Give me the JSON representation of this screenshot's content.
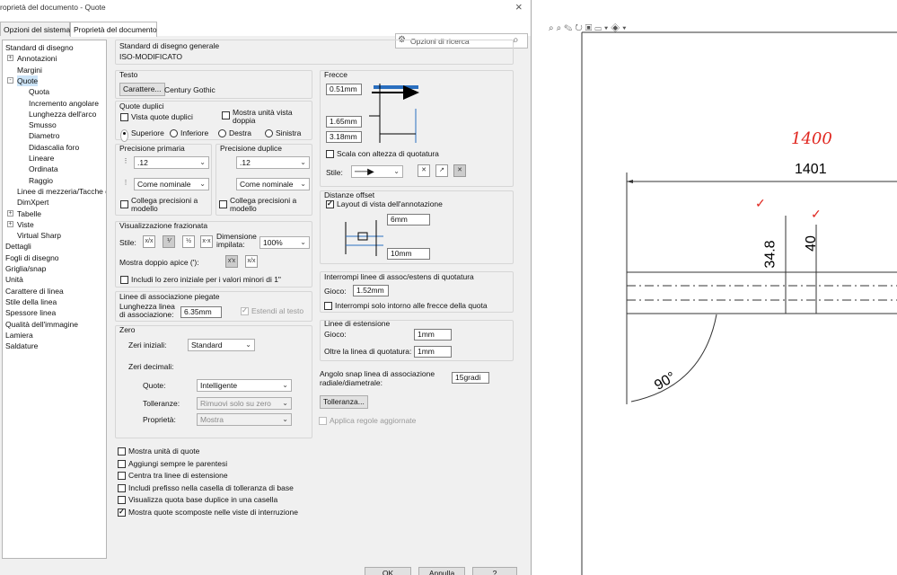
{
  "window": {
    "title": "roprietà del documento - Quote",
    "close": "×"
  },
  "tabs": [
    {
      "label": "Opzioni del sistema"
    },
    {
      "label": "Proprietà del documento"
    }
  ],
  "search": {
    "placeholder": "Opzioni di ricerca"
  },
  "tree": [
    {
      "label": "Standard di disegno",
      "indent": 0,
      "exp": ""
    },
    {
      "label": "Annotazioni",
      "indent": 1,
      "exp": "+"
    },
    {
      "label": "Margini",
      "indent": 1,
      "exp": ""
    },
    {
      "label": "Quote",
      "indent": 1,
      "exp": "-"
    },
    {
      "label": "Quota",
      "indent": 2,
      "exp": ""
    },
    {
      "label": "Incremento angolare",
      "indent": 2,
      "exp": ""
    },
    {
      "label": "Lunghezza dell'arco",
      "indent": 2,
      "exp": ""
    },
    {
      "label": "Smusso",
      "indent": 2,
      "exp": ""
    },
    {
      "label": "Diametro",
      "indent": 2,
      "exp": ""
    },
    {
      "label": "Didascalia foro",
      "indent": 2,
      "exp": ""
    },
    {
      "label": "Lineare",
      "indent": 2,
      "exp": ""
    },
    {
      "label": "Ordinata",
      "indent": 2,
      "exp": ""
    },
    {
      "label": "Raggio",
      "indent": 2,
      "exp": ""
    },
    {
      "label": "Linee di mezzeria/Tacche d",
      "indent": 1,
      "exp": ""
    },
    {
      "label": "DimXpert",
      "indent": 1,
      "exp": ""
    },
    {
      "label": "Tabelle",
      "indent": 1,
      "exp": "+"
    },
    {
      "label": "Viste",
      "indent": 1,
      "exp": "+"
    },
    {
      "label": "Virtual Sharp",
      "indent": 1,
      "exp": ""
    },
    {
      "label": "Dettagli",
      "indent": 0,
      "exp": ""
    },
    {
      "label": "Fogli di disegno",
      "indent": 0,
      "exp": ""
    },
    {
      "label": "Griglia/snap",
      "indent": 0,
      "exp": ""
    },
    {
      "label": "Unità",
      "indent": 0,
      "exp": ""
    },
    {
      "label": "Carattere di linea",
      "indent": 0,
      "exp": ""
    },
    {
      "label": "Stile della linea",
      "indent": 0,
      "exp": ""
    },
    {
      "label": "Spessore linea",
      "indent": 0,
      "exp": ""
    },
    {
      "label": "Qualità dell'immagine",
      "indent": 0,
      "exp": ""
    },
    {
      "label": "Lamiera",
      "indent": 0,
      "exp": ""
    },
    {
      "label": "Saldature",
      "indent": 0,
      "exp": ""
    }
  ],
  "standard": {
    "title": "Standard di disegno generale",
    "value": "ISO-MODIFICATO"
  },
  "testo": {
    "title": "Testo",
    "button": "Carattere...",
    "font": "Century Gothic"
  },
  "dual": {
    "title": "Quote duplici",
    "show": "Vista quote duplici",
    "units": "Mostra unità vista doppia",
    "radios": [
      "Superiore",
      "Inferiore",
      "Destra",
      "Sinistra"
    ]
  },
  "precision": {
    "primary": "Precisione primaria",
    "dual": "Precisione duplice",
    "p1": ".12",
    "p2": "Come nominale",
    "d1": ".12",
    "d2": "Come nominale",
    "link": "Collega precisioni a modello",
    "link2": "Collega precisioni a modello",
    "i1": ".12",
    ".i2": "",
    "icon_a": "1.50 .01",
    "icon_b": "1.50 .01"
  },
  "fraz": {
    "title": "Visualizzazione frazionata",
    "style": "Stile:",
    "stack_label": "Dimensione impilata:",
    "stack_value": "100%",
    "double": "Mostra doppio apice ('):",
    "zero": "Includi lo zero iniziale per i valori minori di 1\""
  },
  "bent": {
    "title": "Linee di associazione piegate",
    "length_label": "Lunghezza linea di associazione:",
    "length": "6.35mm",
    "extend": "Estendi al testo"
  },
  "zero": {
    "title": "Zero",
    "initial_label": "Zeri iniziali:",
    "initial": "Standard",
    "decimal_label": "Zeri decimali:",
    "quote_label": "Quote:",
    "quote": "Intelligente",
    "tol_label": "Tolleranze:",
    "tol": "Rimuovi solo su zero",
    "prop_label": "Proprietà:",
    "prop": "Mostra"
  },
  "frecce": {
    "title": "Frecce",
    "v1": "0.51mm",
    "v2": "1.65mm",
    "v3": "3.18mm",
    "scale": "Scala con altezza di quotatura",
    "style": "Stile:"
  },
  "offset": {
    "title": "Distanze offset",
    "layout": "Layout di vista dell'annotazione",
    "v1": "6mm",
    "v2": "10mm"
  },
  "break": {
    "title": "Interrompi linee di assoc/estens di quotatura",
    "gap_label": "Gioco:",
    "gap": "1.52mm",
    "only": "Interrompi solo intorno alle frecce della quota"
  },
  "ext": {
    "title": "Linee di estensione",
    "gap_label": "Gioco:",
    "gap": "1mm",
    "beyond_label": "Oltre la linea di quotatura:",
    "beyond": "1mm"
  },
  "snap": {
    "label": "Angolo snap linea di associazione radiale/diametrale:",
    "value": "15gradi"
  },
  "tol_btn": "Tolleranza...",
  "apply_rules": "Applica regole aggiornate",
  "checks": [
    {
      "label": "Mostra unità di quote",
      "checked": false
    },
    {
      "label": "Aggiungi sempre le parentesi",
      "checked": false
    },
    {
      "label": "Centra tra linee di estensione",
      "checked": false
    },
    {
      "label": "Includi prefisso nella casella di tolleranza di base",
      "checked": false
    },
    {
      "label": "Visualizza quota base duplice in una casella",
      "checked": false
    },
    {
      "label": "Mostra quote scomposte nelle viste di interruzione",
      "checked": true
    }
  ],
  "footer": {
    "ok": "OK",
    "cancel": "Annulla",
    "help": "?"
  },
  "drawing": {
    "dim_top": "1401",
    "dim_v1": "34.8",
    "dim_v2": "40",
    "angle": "90°",
    "handwritten": "1400",
    "check": "✓",
    "colors": {
      "red": "#e0261f"
    }
  }
}
